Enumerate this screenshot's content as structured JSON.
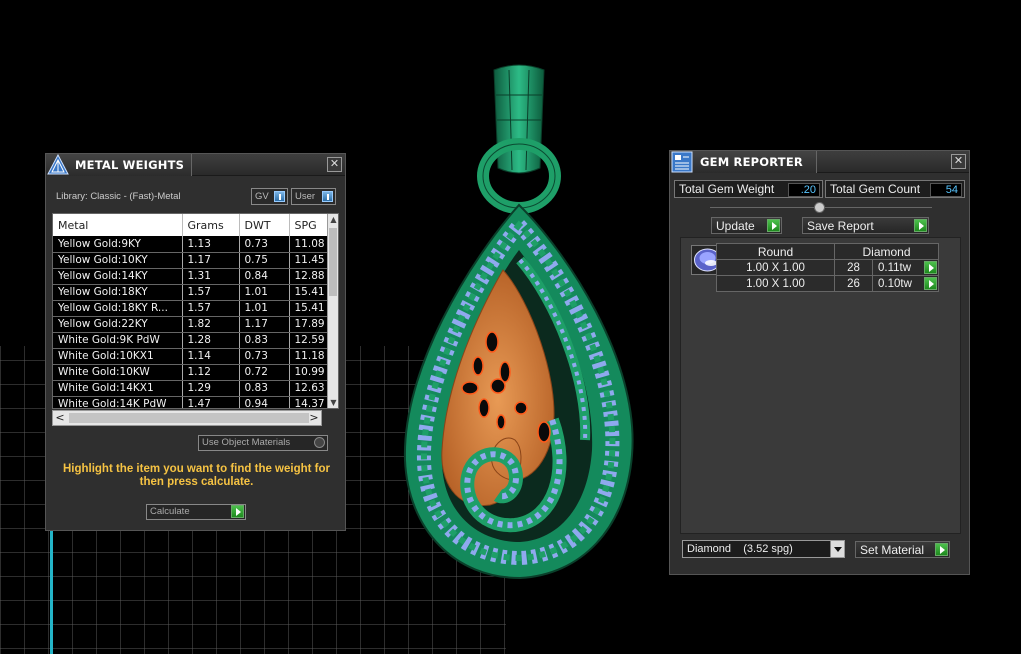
{
  "metal_weights": {
    "title": "METAL WEIGHTS",
    "library": "Library: Classic - (Fast)-Metal",
    "toggle_gv": "GV",
    "toggle_user": "User",
    "columns": [
      "Metal",
      "Grams",
      "DWT",
      "SPG"
    ],
    "rows": [
      [
        "Yellow Gold:9KY",
        "1.13",
        "0.73",
        "11.08"
      ],
      [
        "Yellow Gold:10KY",
        "1.17",
        "0.75",
        "11.45"
      ],
      [
        "Yellow Gold:14KY",
        "1.31",
        "0.84",
        "12.88"
      ],
      [
        "Yellow Gold:18KY",
        "1.57",
        "1.01",
        "15.41"
      ],
      [
        "Yellow Gold:18KY R...",
        "1.57",
        "1.01",
        "15.41"
      ],
      [
        "Yellow Gold:22KY",
        "1.82",
        "1.17",
        "17.89"
      ],
      [
        "White Gold:9K PdW",
        "1.28",
        "0.83",
        "12.59"
      ],
      [
        "White Gold:10KX1",
        "1.14",
        "0.73",
        "11.18"
      ],
      [
        "White Gold:10KW",
        "1.12",
        "0.72",
        "10.99"
      ],
      [
        "White Gold:14KX1",
        "1.29",
        "0.83",
        "12.63"
      ],
      [
        "White Gold:14K PdW",
        "1.47",
        "0.94",
        "14.37"
      ]
    ],
    "use_object_materials": "Use Object Materials",
    "hint": "Highlight the item you want to find the weight for then press calculate.",
    "calculate": "Calculate"
  },
  "gem_reporter": {
    "title": "GEM REPORTER",
    "total_weight_label": "Total Gem Weight",
    "total_weight_value": ".20",
    "total_count_label": "Total Gem Count",
    "total_count_value": "54",
    "update": "Update",
    "save_report": "Save Report",
    "grid_headers": [
      "Round",
      "Diamond"
    ],
    "grid_rows": [
      [
        "1.00 X 1.00",
        "28",
        "0.11tw"
      ],
      [
        "1.00 X 1.00",
        "26",
        "0.10tw"
      ]
    ],
    "material_select": "Diamond    (3.52 spg)",
    "set_material": "Set Material"
  },
  "colors": {
    "metal_orange": "#e3833d",
    "gem_blue": "#8fa9ee",
    "green": "#1e9f68",
    "hint_yellow": "#f6c343",
    "value_blue": "#58c6ff"
  }
}
